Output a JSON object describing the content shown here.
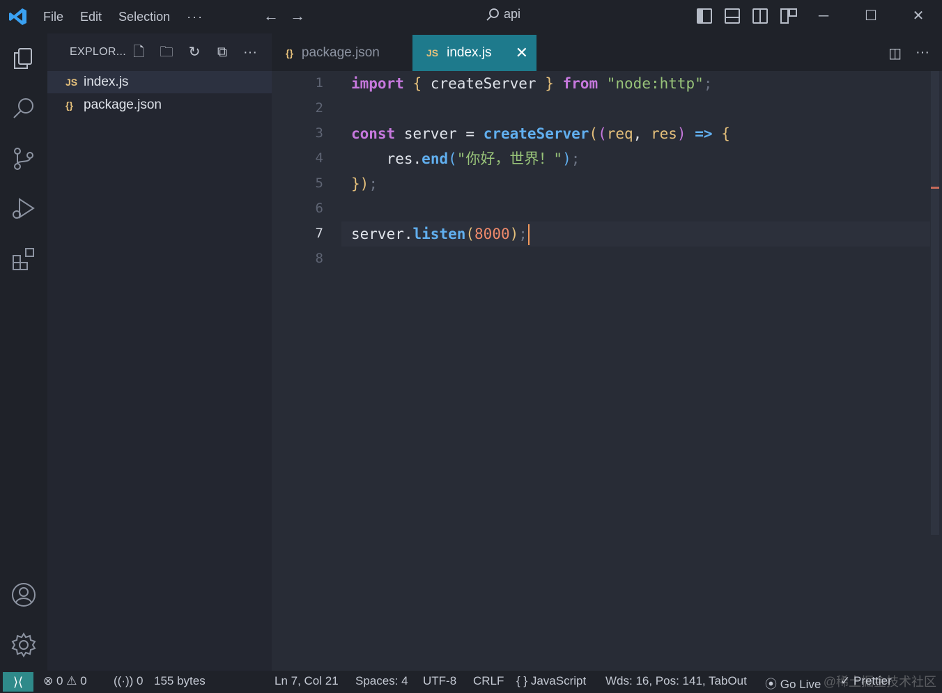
{
  "menu": {
    "file": "File",
    "edit": "Edit",
    "selection": "Selection",
    "more": "···"
  },
  "title": {
    "search_text": "api"
  },
  "sidebar": {
    "title": "EXPLOR...",
    "files": [
      {
        "icon": "JS",
        "name": "index.js",
        "selected": true
      },
      {
        "icon": "{}",
        "name": "package.json",
        "selected": false
      }
    ]
  },
  "tabs": [
    {
      "icon": "{}",
      "label": "package.json",
      "active": false
    },
    {
      "icon": "JS",
      "label": "index.js",
      "active": true,
      "close": "✕"
    }
  ],
  "editor": {
    "line_numbers": [
      "1",
      "2",
      "3",
      "4",
      "5",
      "6",
      "7",
      "8"
    ],
    "current_line": 7,
    "code": {
      "l1": {
        "kw_import": "import",
        "brace_open": "{",
        "name": "createServer",
        "brace_close": "}",
        "kw_from": "from",
        "module": "\"node:http\"",
        "semi": ";"
      },
      "l3": {
        "kw_const": "const",
        "var": "server",
        "eq": "=",
        "fn": "createServer",
        "p1": "(",
        "p2": "(",
        "req": "req",
        "comma": ",",
        "res": "res",
        "p3": ")",
        "arrow": "=>",
        "brace": "{"
      },
      "l4": {
        "obj": "res",
        "dot": ".",
        "fn": "end",
        "p1": "(",
        "str": "\"你好，世界！\"",
        "p2": ")",
        "semi": ";"
      },
      "l5": {
        "brace": "}",
        "paren": ")",
        "semi": ";"
      },
      "l7": {
        "obj": "server",
        "dot": ".",
        "fn": "listen",
        "p1": "(",
        "num": "8000",
        "p2": ")",
        "semi": ";"
      }
    }
  },
  "status": {
    "errors": "0",
    "warnings": "0",
    "ports": "0",
    "size": "155 bytes",
    "position": "Ln 7, Col 21",
    "spaces": "Spaces: 4",
    "encoding": "UTF-8",
    "eol": "CRLF",
    "language_icon": "{ }",
    "language": "JavaScript",
    "tabout": "Wds: 16, Pos: 141, TabOut",
    "golive": "Go Live",
    "prettier": "Prettier",
    "watermark": "@稀土掘金技术社区"
  },
  "colors": {
    "accent": "#1e7a8c",
    "keyword": "#c678dd",
    "function": "#61afef",
    "string": "#98c379",
    "number": "#ef8a6b",
    "caret": "#f29a5e"
  }
}
